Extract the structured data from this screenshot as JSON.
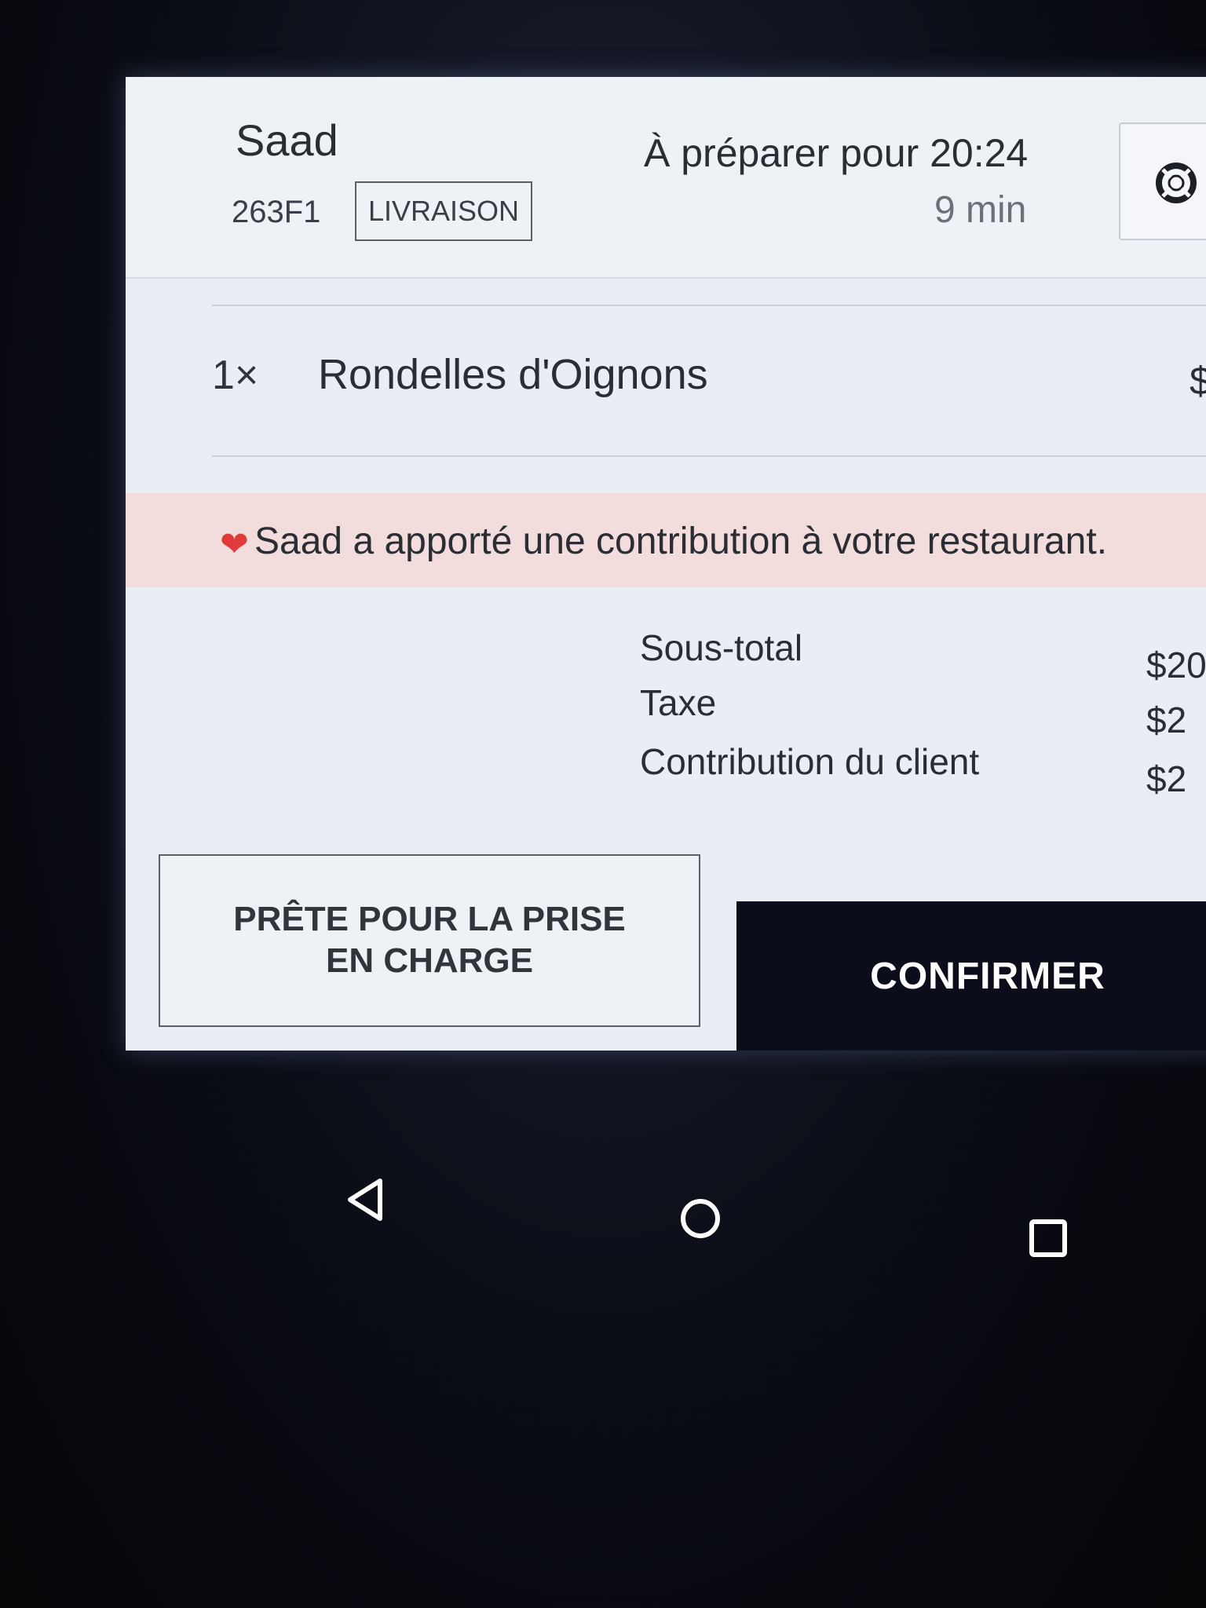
{
  "order": {
    "customer_name": "Saad",
    "order_id": "263F1",
    "type_badge": "LIVRAISON",
    "prep_label": "À préparer pour 20:24",
    "prep_eta": "9 min"
  },
  "items": [
    {
      "qty": "1×",
      "name": "Rondelles d'Oignons",
      "price": "$"
    }
  ],
  "contribution_banner": {
    "text": "Saad a apporté une contribution à votre restaurant.",
    "icon": "heart-icon",
    "color": "#e03a3a"
  },
  "totals": [
    {
      "label": "Sous-total",
      "value": "$20"
    },
    {
      "label": "Taxe",
      "value": "$2"
    },
    {
      "label": "Contribution du client",
      "value": "$2"
    }
  ],
  "actions": {
    "pickup_label": "PRÊTE POUR LA PRISE EN CHARGE",
    "confirm_label": "CONFIRMER"
  },
  "icons": {
    "help": "lifebuoy-icon",
    "nav_back": "nav-back-icon",
    "nav_home": "nav-home-icon",
    "nav_recent": "nav-recent-icon"
  },
  "colors": {
    "confirm_bg": "#0b0d1a",
    "banner_bg": "#f2dcdc"
  }
}
